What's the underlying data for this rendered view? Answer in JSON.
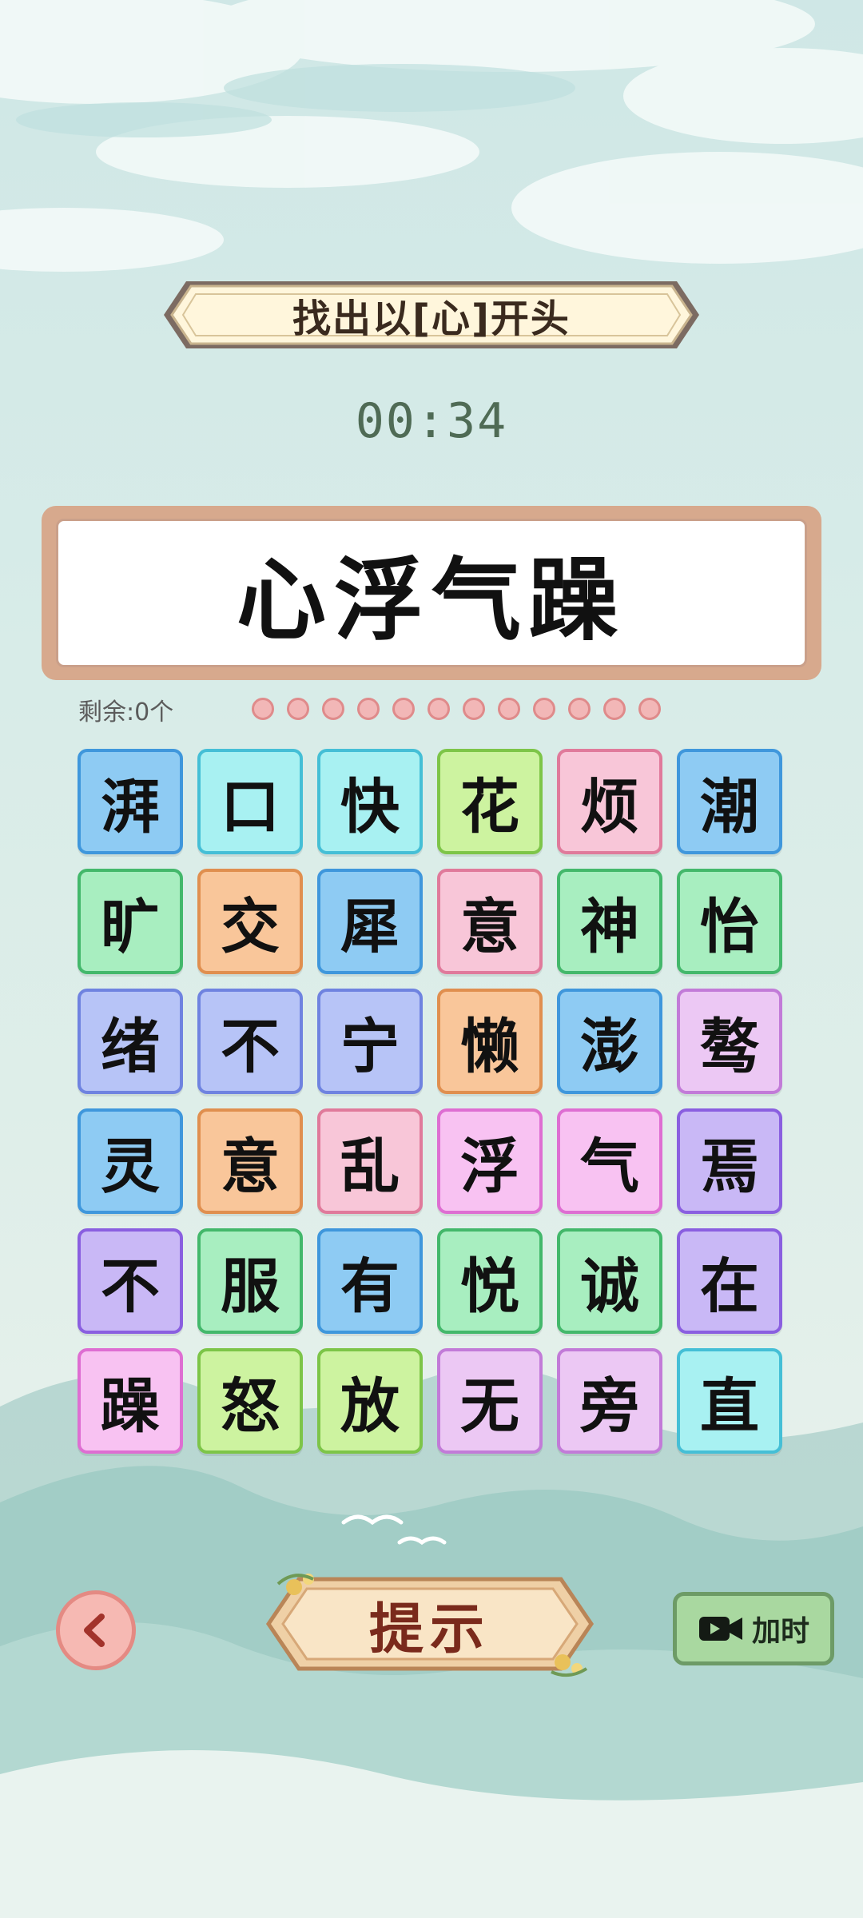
{
  "prompt": {
    "text": "找出以[心]开头"
  },
  "timer": {
    "value": "00:34"
  },
  "answer": {
    "text": "心浮气躁"
  },
  "remaining": {
    "label": "剩余:0个"
  },
  "progress_dots": 12,
  "board": {
    "rows": [
      [
        {
          "ch": "湃",
          "color": "blue"
        },
        {
          "ch": "口",
          "color": "cyan"
        },
        {
          "ch": "快",
          "color": "cyan"
        },
        {
          "ch": "花",
          "color": "lime"
        },
        {
          "ch": "烦",
          "color": "pink"
        },
        {
          "ch": "潮",
          "color": "blue"
        }
      ],
      [
        {
          "ch": "旷",
          "color": "green"
        },
        {
          "ch": "交",
          "color": "orange"
        },
        {
          "ch": "犀",
          "color": "blue"
        },
        {
          "ch": "意",
          "color": "pink"
        },
        {
          "ch": "神",
          "color": "green"
        },
        {
          "ch": "怡",
          "color": "green"
        }
      ],
      [
        {
          "ch": "绪",
          "color": "peri"
        },
        {
          "ch": "不",
          "color": "peri"
        },
        {
          "ch": "宁",
          "color": "peri"
        },
        {
          "ch": "懒",
          "color": "orange"
        },
        {
          "ch": "澎",
          "color": "blue"
        },
        {
          "ch": "骜",
          "color": "lav"
        }
      ],
      [
        {
          "ch": "灵",
          "color": "blue"
        },
        {
          "ch": "意",
          "color": "orange"
        },
        {
          "ch": "乱",
          "color": "pink"
        },
        {
          "ch": "浮",
          "color": "mag"
        },
        {
          "ch": "气",
          "color": "mag"
        },
        {
          "ch": "焉",
          "color": "purple"
        }
      ],
      [
        {
          "ch": "不",
          "color": "purple"
        },
        {
          "ch": "服",
          "color": "green"
        },
        {
          "ch": "有",
          "color": "blue"
        },
        {
          "ch": "悦",
          "color": "green"
        },
        {
          "ch": "诚",
          "color": "green"
        },
        {
          "ch": "在",
          "color": "purple"
        }
      ],
      [
        {
          "ch": "躁",
          "color": "mag"
        },
        {
          "ch": "怒",
          "color": "lime"
        },
        {
          "ch": "放",
          "color": "lime"
        },
        {
          "ch": "无",
          "color": "lav"
        },
        {
          "ch": "旁",
          "color": "lav"
        },
        {
          "ch": "直",
          "color": "cyan"
        }
      ]
    ]
  },
  "buttons": {
    "back_icon": "chevron-left-icon",
    "hint_label": "提示",
    "add_time_label": "加时",
    "add_time_icon": "video-camera-icon"
  }
}
